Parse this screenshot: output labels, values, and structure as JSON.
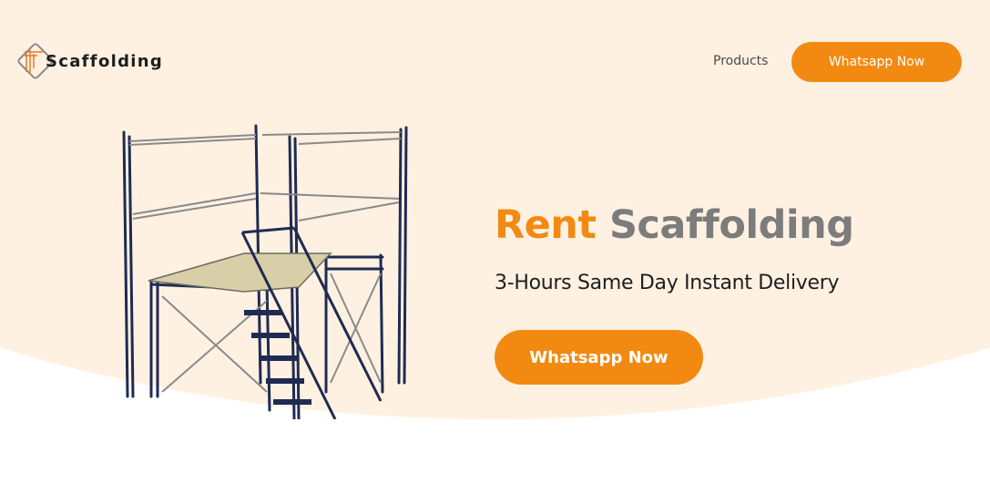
{
  "brand": {
    "name": "Scaffolding",
    "logo_icon": "scaffold-frame-logo"
  },
  "nav": {
    "products_label": "Products",
    "cta_label": "Whatsapp Now"
  },
  "hero": {
    "title_accent": "Rent",
    "title_rest": "Scaffolding",
    "subtitle": "3-Hours Same Day Instant Delivery",
    "cta_label": "Whatsapp Now",
    "image_icon": "scaffolding-tower-image"
  },
  "colors": {
    "accent": "#f28a12",
    "hero_background": "#fff1e2",
    "title_gray": "#7c7c7c",
    "text_dark": "#1e1e1e",
    "steel_frame": "#1f2b52"
  }
}
